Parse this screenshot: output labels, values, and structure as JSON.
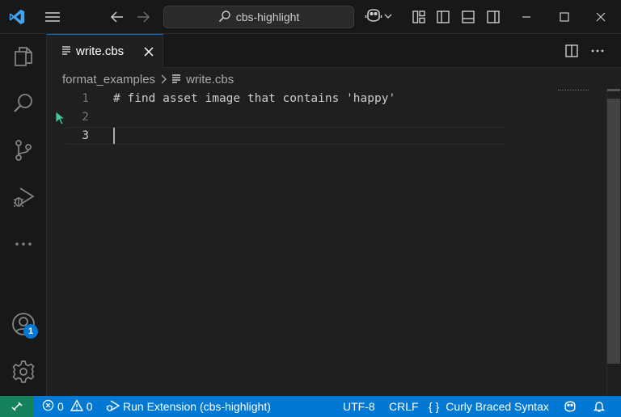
{
  "window": {
    "search_text": "cbs-highlight"
  },
  "tab": {
    "filename": "write.cbs"
  },
  "breadcrumb": {
    "folder": "format_examples",
    "file": "write.cbs"
  },
  "editor": {
    "lines": [
      {
        "number": "1",
        "text": "# find asset image that contains 'happy'"
      },
      {
        "number": "2",
        "text": ""
      },
      {
        "number": "3",
        "text": ""
      }
    ]
  },
  "activity": {
    "accounts_badge": "1"
  },
  "statusbar": {
    "errors": "0",
    "warnings": "0",
    "run_extension": "Run Extension (cbs-highlight)",
    "encoding": "UTF-8",
    "eol": "CRLF",
    "language_icon": "{ }",
    "language": "Curly Braced Syntax"
  },
  "colors": {
    "accent": "#0078d4",
    "remote": "#16825d",
    "background": "#1f1f1f",
    "chrome": "#181818"
  },
  "icons": [
    "vscode-logo-icon",
    "menu-icon",
    "arrow-left-icon",
    "arrow-right-icon",
    "search-icon",
    "copilot-icon",
    "chevron-down-icon",
    "layout-icon",
    "toggle-sidebar-icon",
    "toggle-panel-icon",
    "toggle-secondary-sidebar-icon",
    "minimize-icon",
    "maximize-icon",
    "close-icon",
    "explorer-icon",
    "search-view-icon",
    "source-control-icon",
    "run-debug-icon",
    "more-icon",
    "accounts-icon",
    "gear-icon",
    "split-editor-icon",
    "remote-icon",
    "error-icon",
    "warning-icon",
    "bell-icon"
  ]
}
